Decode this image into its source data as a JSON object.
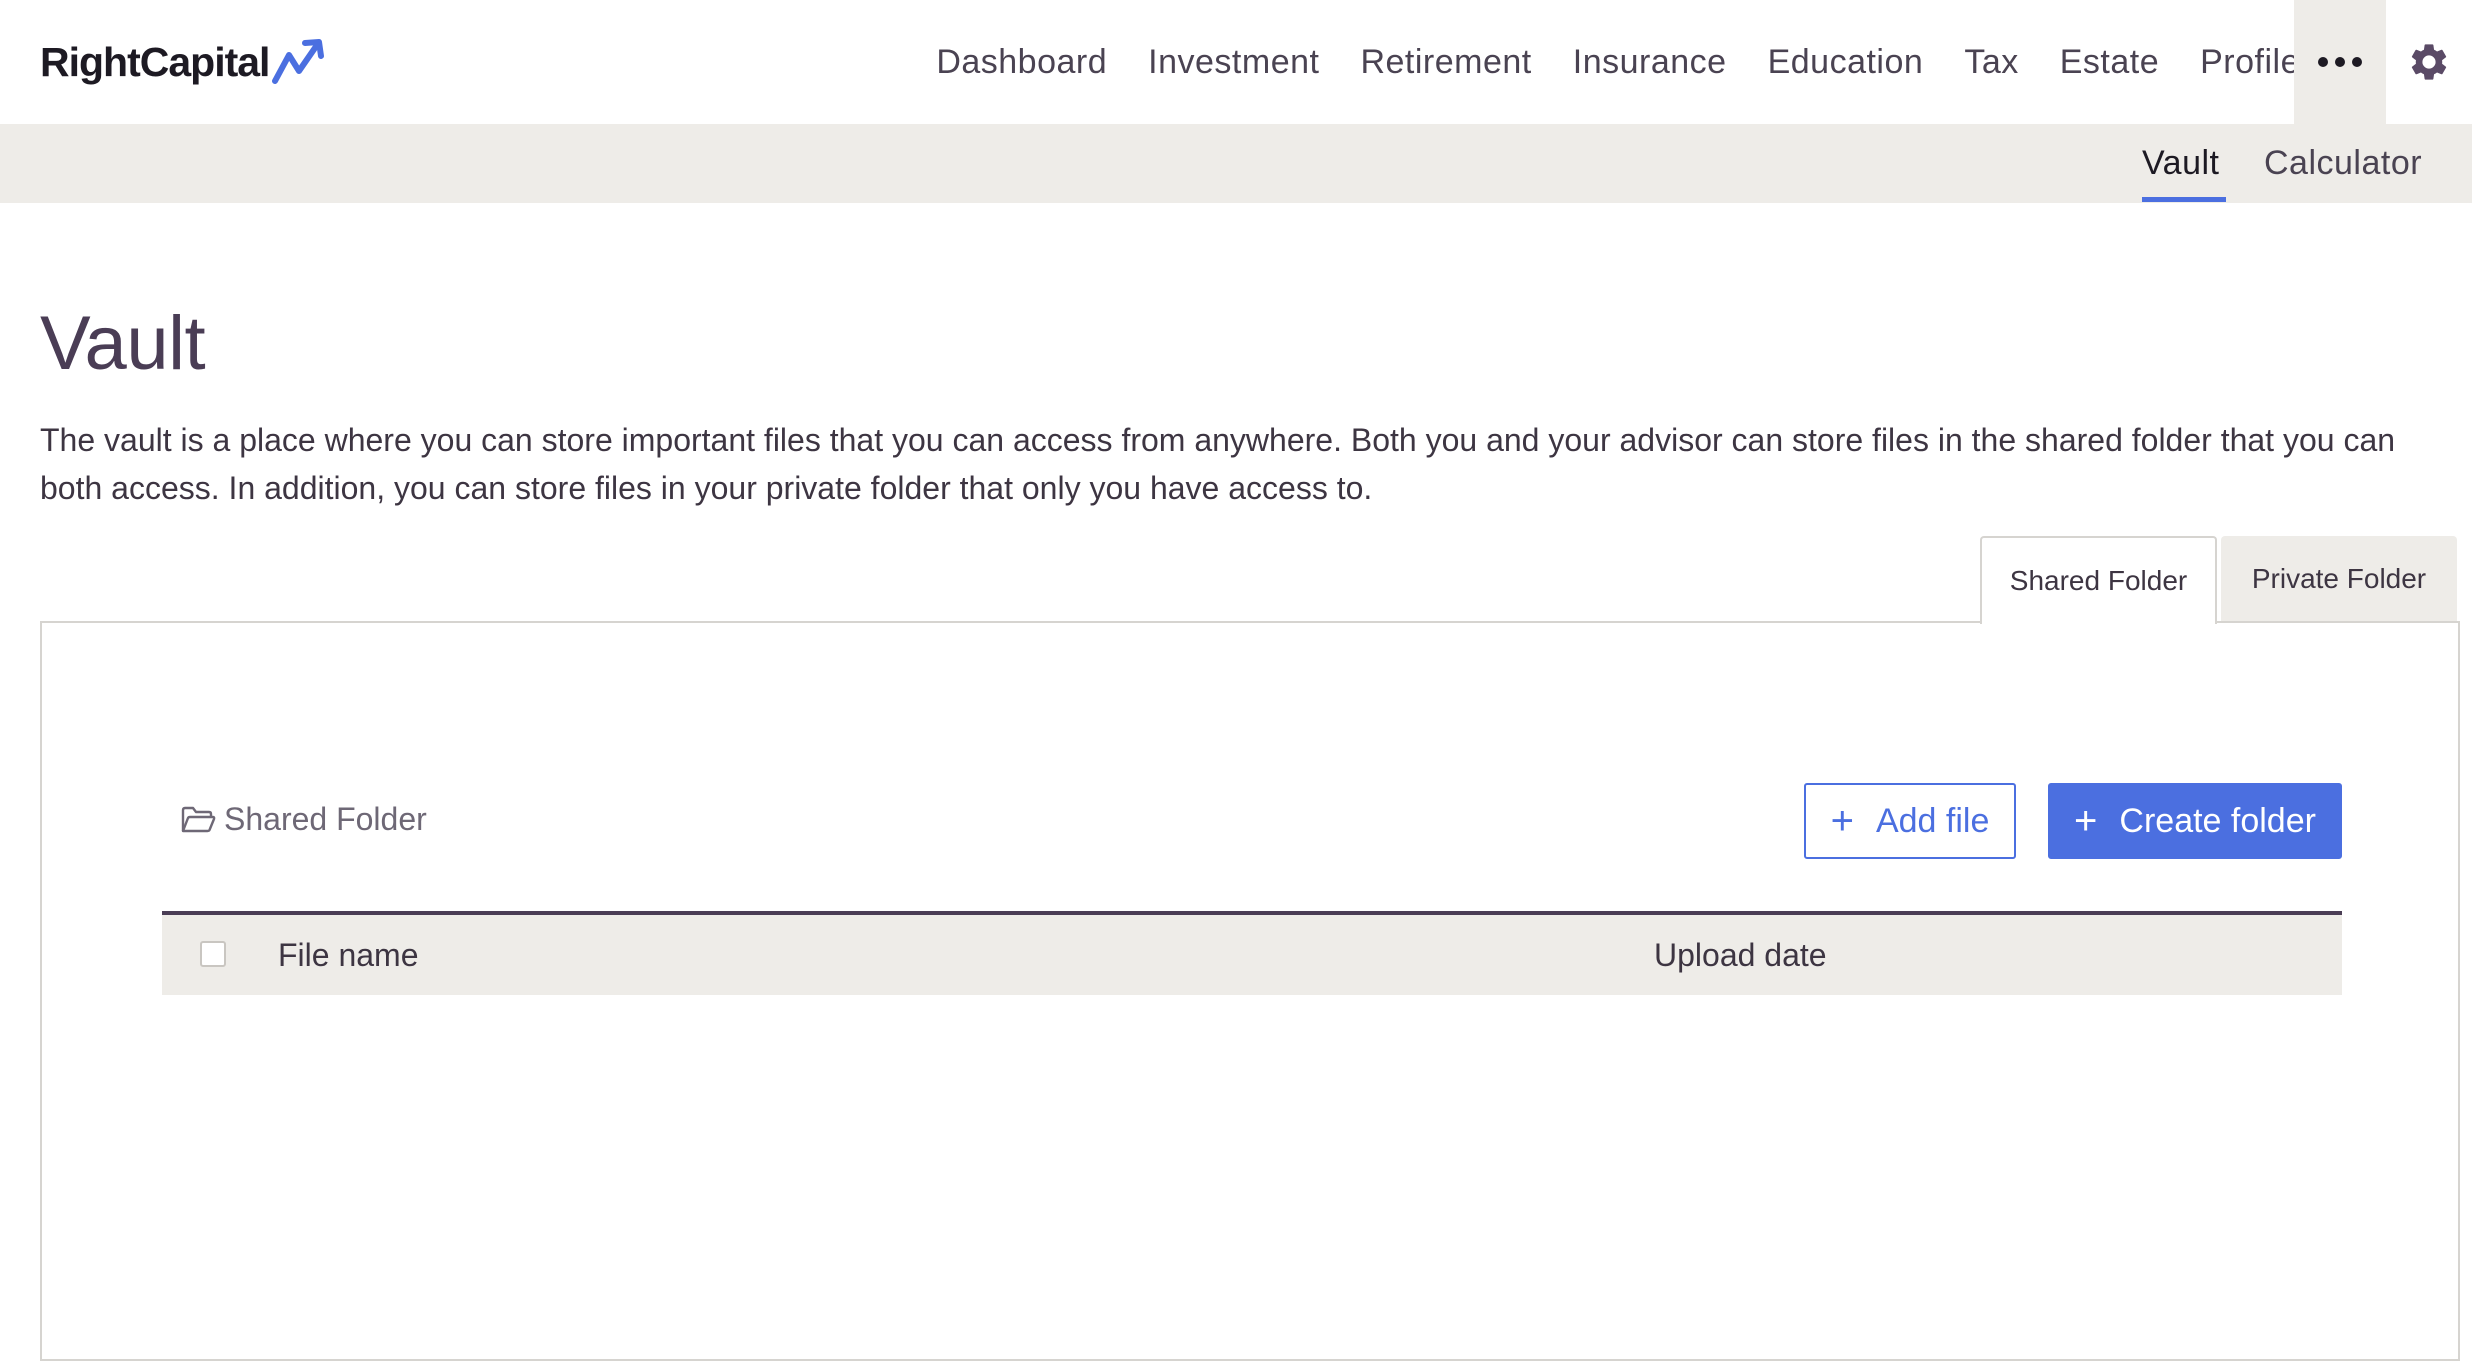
{
  "app": {
    "logo_text": "RightCapital"
  },
  "nav": {
    "items": [
      "Dashboard",
      "Investment",
      "Retirement",
      "Insurance",
      "Education",
      "Tax",
      "Estate",
      "Profile"
    ],
    "more_icon": "more-dots-icon",
    "settings_icon": "gear-icon"
  },
  "subnav": {
    "vault": "Vault",
    "calculator": "Calculator",
    "active": "Vault"
  },
  "page": {
    "title": "Vault",
    "description": "The vault is a place where you can store important files that you can access from anywhere. Both you and your advisor can store files in the shared folder that you can both access. In addition, you can store files in your private folder that only you have access to."
  },
  "folder_tabs": {
    "shared": "Shared Folder",
    "private": "Private Folder",
    "active": "Shared Folder"
  },
  "panel": {
    "current_folder": "Shared Folder",
    "folder_icon": "folder-open-icon",
    "add_file_label": "Add file",
    "create_folder_label": "Create folder",
    "table": {
      "columns": [
        "File name",
        "Upload date"
      ],
      "rows": []
    }
  },
  "colors": {
    "accent": "#4b6fe0",
    "heading": "#4a3d55",
    "bar_bg": "#eeece8"
  }
}
